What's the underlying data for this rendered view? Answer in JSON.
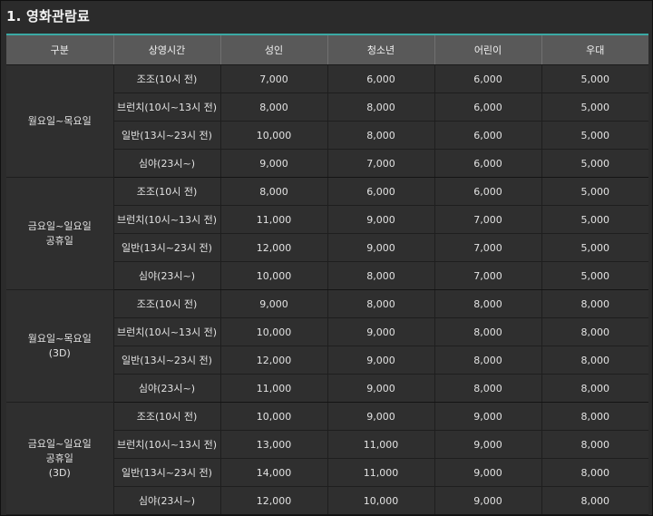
{
  "title": "1. 영화관람료",
  "columns": [
    "구분",
    "상영시간",
    "성인",
    "청소년",
    "어린이",
    "우대"
  ],
  "groups": [
    {
      "label": [
        "월요일~목요일"
      ],
      "rows": [
        [
          "조조(10시 전)",
          "7,000",
          "6,000",
          "6,000",
          "5,000"
        ],
        [
          "브런치(10시~13시 전)",
          "8,000",
          "8,000",
          "6,000",
          "5,000"
        ],
        [
          "일반(13시~23시 전)",
          "10,000",
          "8,000",
          "6,000",
          "5,000"
        ],
        [
          "심야(23시~)",
          "9,000",
          "7,000",
          "6,000",
          "5,000"
        ]
      ]
    },
    {
      "label": [
        "금요일~일요일",
        "공휴일"
      ],
      "rows": [
        [
          "조조(10시 전)",
          "8,000",
          "6,000",
          "6,000",
          "5,000"
        ],
        [
          "브런치(10시~13시 전)",
          "11,000",
          "9,000",
          "7,000",
          "5,000"
        ],
        [
          "일반(13시~23시 전)",
          "12,000",
          "9,000",
          "7,000",
          "5,000"
        ],
        [
          "심야(23시~)",
          "10,000",
          "8,000",
          "7,000",
          "5,000"
        ]
      ]
    },
    {
      "label": [
        "월요일~목요일",
        "(3D)"
      ],
      "rows": [
        [
          "조조(10시 전)",
          "9,000",
          "8,000",
          "8,000",
          "8,000"
        ],
        [
          "브런치(10시~13시 전)",
          "10,000",
          "9,000",
          "8,000",
          "8,000"
        ],
        [
          "일반(13시~23시 전)",
          "12,000",
          "9,000",
          "8,000",
          "8,000"
        ],
        [
          "심야(23시~)",
          "11,000",
          "9,000",
          "8,000",
          "8,000"
        ]
      ]
    },
    {
      "label": [
        "금요일~일요일",
        "공휴일",
        "(3D)"
      ],
      "rows": [
        [
          "조조(10시 전)",
          "10,000",
          "9,000",
          "9,000",
          "8,000"
        ],
        [
          "브런치(10시~13시 전)",
          "13,000",
          "11,000",
          "9,000",
          "8,000"
        ],
        [
          "일반(13시~23시 전)",
          "14,000",
          "11,000",
          "9,000",
          "8,000"
        ],
        [
          "심야(23시~)",
          "12,000",
          "10,000",
          "9,000",
          "8,000"
        ]
      ]
    }
  ]
}
